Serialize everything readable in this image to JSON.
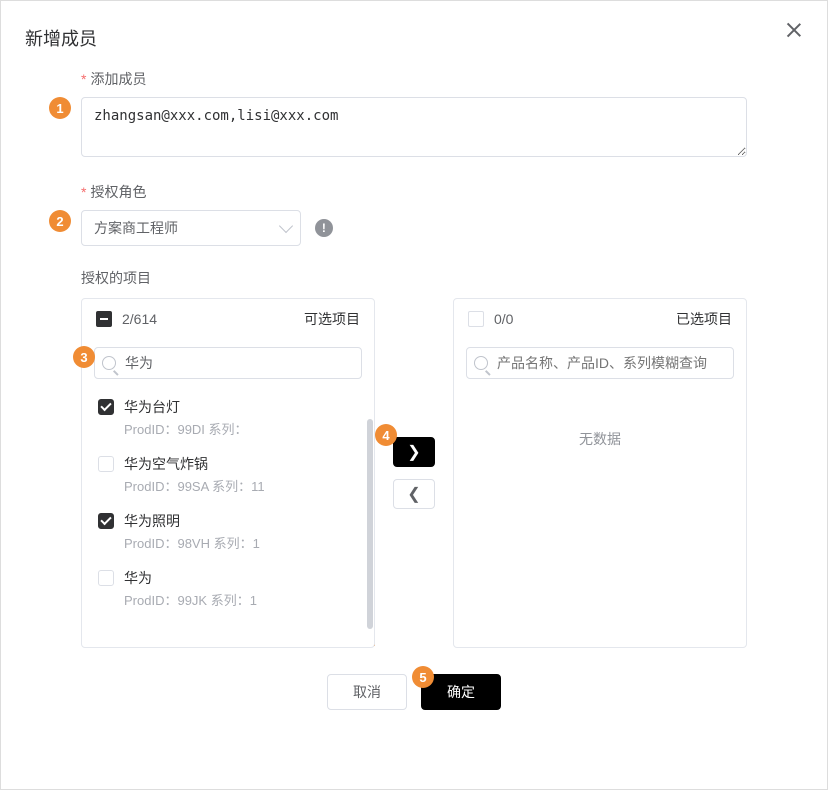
{
  "dialog": {
    "title": "新增成员",
    "close_label": "close"
  },
  "form": {
    "members": {
      "label": "添加成员",
      "value": "zhangsan@xxx.com,lisi@xxx.com"
    },
    "role": {
      "label": "授权角色",
      "selected": "方案商工程师",
      "info_tooltip": "info"
    },
    "projects_label": "授权的项目"
  },
  "transfer": {
    "left": {
      "header_count": "2/614",
      "header_title": "可选项目",
      "header_indeterminate": true,
      "search_value": "华为",
      "items": [
        {
          "checked": true,
          "title": "华为台灯",
          "sub": "ProdID：99DI 系列："
        },
        {
          "checked": false,
          "title": "华为空气炸锅",
          "sub": "ProdID：99SA 系列：11"
        },
        {
          "checked": true,
          "title": "华为照明",
          "sub": "ProdID：98VH 系列：1"
        },
        {
          "checked": false,
          "title": "华为",
          "sub": "ProdID：99JK 系列：1"
        }
      ]
    },
    "right": {
      "header_count": "0/0",
      "header_title": "已选项目",
      "search_placeholder": "产品名称、产品ID、系列模糊查询",
      "empty_text": "无数据"
    },
    "btn_right": "›",
    "btn_left": "‹"
  },
  "footer": {
    "cancel": "取消",
    "confirm": "确定"
  },
  "callouts": {
    "c1": "1",
    "c2": "2",
    "c3": "3",
    "c4": "4",
    "c5": "5"
  }
}
